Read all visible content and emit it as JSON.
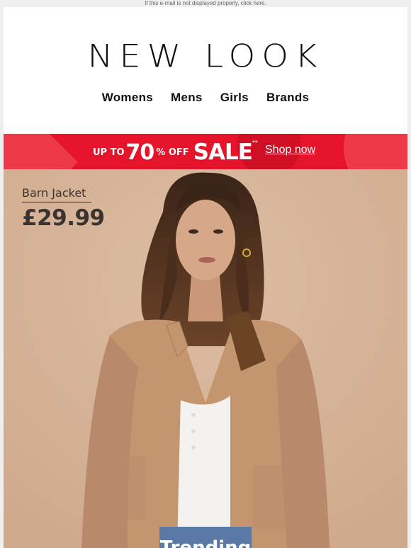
{
  "preheader": "If this e-mail is not displayed properly, click here.",
  "logo": "NEW LOOK",
  "nav": [
    "Womens",
    "Mens",
    "Girls",
    "Brands"
  ],
  "sale_banner": {
    "up_to": "UP TO",
    "percent": "70",
    "percent_off": "% OFF",
    "sale": "SALE",
    "stars": "**",
    "cta": "Shop now",
    "colors": {
      "background": "#e5142a",
      "text": "#ffffff"
    }
  },
  "hero": {
    "product_name": "Barn Jacket",
    "price": "£29.99",
    "footer_text": "Trending",
    "background_color": "#d8b59a"
  }
}
